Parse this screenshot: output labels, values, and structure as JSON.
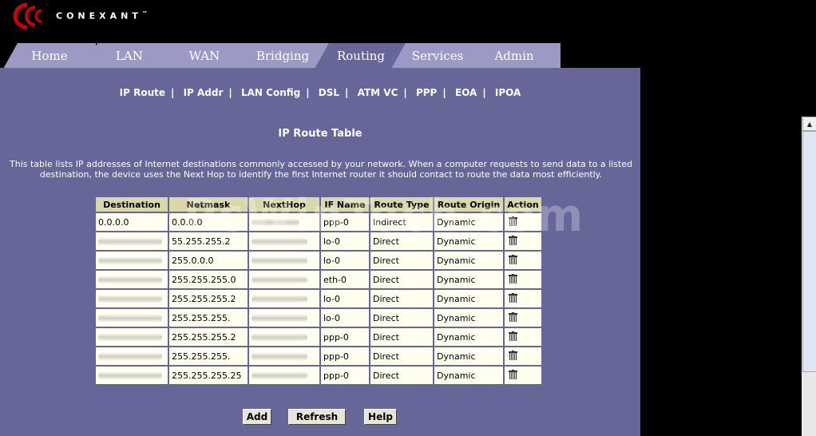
{
  "brand": {
    "name": "CONEXANT",
    "trademark": "™"
  },
  "tabs": [
    {
      "label": "Home"
    },
    {
      "label": "LAN"
    },
    {
      "label": "WAN"
    },
    {
      "label": "Bridging"
    },
    {
      "label": "Routing",
      "active": true
    },
    {
      "label": "Services"
    },
    {
      "label": "Admin"
    }
  ],
  "subnav": [
    {
      "label": "IP Route"
    },
    {
      "label": "IP Addr"
    },
    {
      "label": "LAN Config"
    },
    {
      "label": "DSL"
    },
    {
      "label": "ATM VC"
    },
    {
      "label": "PPP"
    },
    {
      "label": "EOA"
    },
    {
      "label": "IPOA"
    }
  ],
  "page": {
    "title": "IP Route Table",
    "description": "This table lists IP addresses of Internet destinations commonly accessed by your network. When a computer requests to send data to a listed destination, the device uses the Next Hop to identify the first Internet router it should contact to route the data most efficiently."
  },
  "table": {
    "headers": [
      "Destination",
      "Netmask",
      "NextHop",
      "IF Name",
      "Route Type",
      "Route Origin",
      "Action"
    ],
    "rows": [
      {
        "destination": "0.0.0.0",
        "netmask": "0.0.0.0",
        "nexthop": "",
        "if_name": "ppp-0",
        "route_type": "Indirect",
        "route_origin": "Dynamic"
      },
      {
        "destination": "",
        "netmask": "55.255.255.2",
        "nexthop": "",
        "if_name": "lo-0",
        "route_type": "Direct",
        "route_origin": "Dynamic"
      },
      {
        "destination": "",
        "netmask": "255.0.0.0",
        "nexthop": "",
        "if_name": "lo-0",
        "route_type": "Direct",
        "route_origin": "Dynamic"
      },
      {
        "destination": "",
        "netmask": "255.255.255.0",
        "nexthop": "",
        "if_name": "eth-0",
        "route_type": "Direct",
        "route_origin": "Dynamic"
      },
      {
        "destination": "",
        "netmask": "255.255.255.2",
        "nexthop": "",
        "if_name": "lo-0",
        "route_type": "Direct",
        "route_origin": "Dynamic"
      },
      {
        "destination": "",
        "netmask": "255.255.255.",
        "nexthop": "",
        "if_name": "lo-0",
        "route_type": "Direct",
        "route_origin": "Dynamic"
      },
      {
        "destination": "",
        "netmask": "255.255.255.2",
        "nexthop": "",
        "if_name": "ppp-0",
        "route_type": "Direct",
        "route_origin": "Dynamic"
      },
      {
        "destination": "",
        "netmask": "255.255.255.",
        "nexthop": "",
        "if_name": "ppp-0",
        "route_type": "Direct",
        "route_origin": "Dynamic"
      },
      {
        "destination": "",
        "netmask": "255.255.255.25",
        "nexthop": "",
        "if_name": "ppp-0",
        "route_type": "Direct",
        "route_origin": "Dynamic"
      }
    ]
  },
  "buttons": {
    "add": "Add",
    "refresh": "Refresh",
    "help": "Help"
  },
  "watermark": "PcWinTech.com",
  "colors": {
    "panel": "#666699",
    "tab_inactive": "#9a9ac4",
    "header_cell": "#d8d8a8",
    "cell": "#fffff0",
    "logo_red": "#cc0000"
  },
  "icons": {
    "delete": "trash-icon",
    "logo": "conexant-logo-icon"
  }
}
